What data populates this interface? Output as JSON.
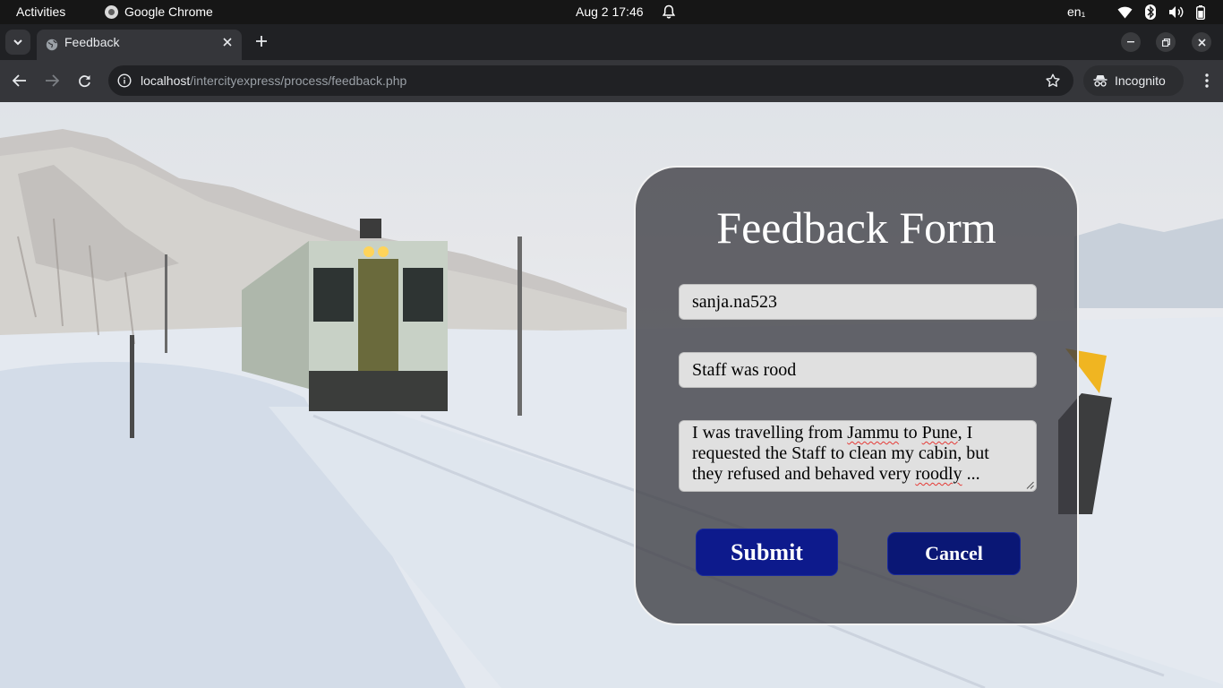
{
  "system_bar": {
    "activities": "Activities",
    "app_name": "Google Chrome",
    "clock": "Aug 2  17:46",
    "language": "en₁"
  },
  "browser": {
    "tab_title": "Feedback",
    "url_host": "localhost",
    "url_path": "/intercityexpress/process/feedback.php",
    "incognito_label": "Incognito"
  },
  "form": {
    "title": "Feedback Form",
    "username_value": "sanja.na523",
    "subject_value": "Staff was rood",
    "message_parts": {
      "p1": "I was travelling from ",
      "w1": "Jammu",
      "p2": " to ",
      "w2": "Pune",
      "p3": ", I requested the Staff to clean my cabin, but they refused and behaved very ",
      "w3": "roodly",
      "p4": " ..."
    },
    "submit_label": "Submit",
    "cancel_label": "Cancel"
  },
  "colors": {
    "button_bg": "#0d1a8c",
    "card_bg": "#3c3c42",
    "spellcheck": "#e53935"
  },
  "icons": [
    "chrome-icon",
    "bell-icon",
    "wifi-icon",
    "bluetooth-icon",
    "volume-icon",
    "battery-icon",
    "globe-icon",
    "close-icon",
    "plus-icon",
    "back-icon",
    "forward-icon",
    "reload-icon",
    "site-info-icon",
    "star-icon",
    "incognito-icon",
    "menu-icon"
  ]
}
